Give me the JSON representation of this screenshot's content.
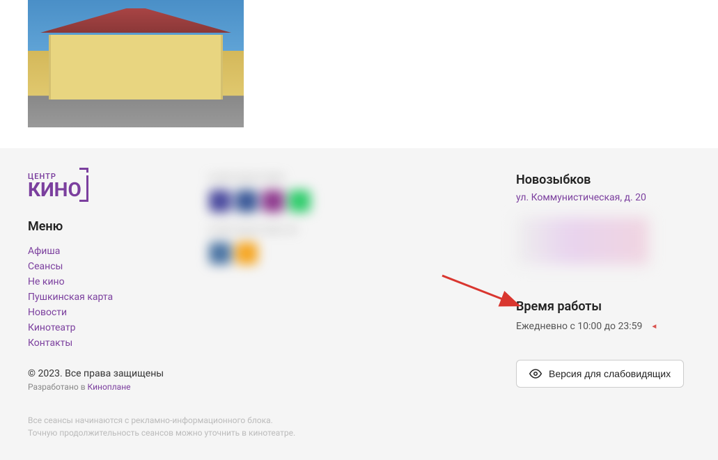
{
  "logo": {
    "top": "ЦЕНТР",
    "main": "КИНО"
  },
  "menu": {
    "title": "Меню",
    "items": [
      {
        "label": "Афиша"
      },
      {
        "label": "Сеансы"
      },
      {
        "label": "Не кино"
      },
      {
        "label": "Пушкинская карта"
      },
      {
        "label": "Новости"
      },
      {
        "label": "Кинотеатр"
      },
      {
        "label": "Контакты"
      }
    ]
  },
  "location": {
    "city": "Новозыбков",
    "address": "ул. Коммунистическая, д. 20"
  },
  "hours": {
    "title": "Время работы",
    "text": "Ежедневно с 10:00 до 23:59"
  },
  "accessibility": {
    "label": "Версия для слабовидящих"
  },
  "copyright": {
    "text": "© 2023. Все права защищены",
    "dev_prefix": "Разработано в ",
    "dev_link": "Киноплане"
  },
  "disclaimer": {
    "line1": "Все сеансы начинаются с рекламно-информационного блока.",
    "line2": "Точную продолжительность сеансов можно уточнить в кинотеатре."
  }
}
